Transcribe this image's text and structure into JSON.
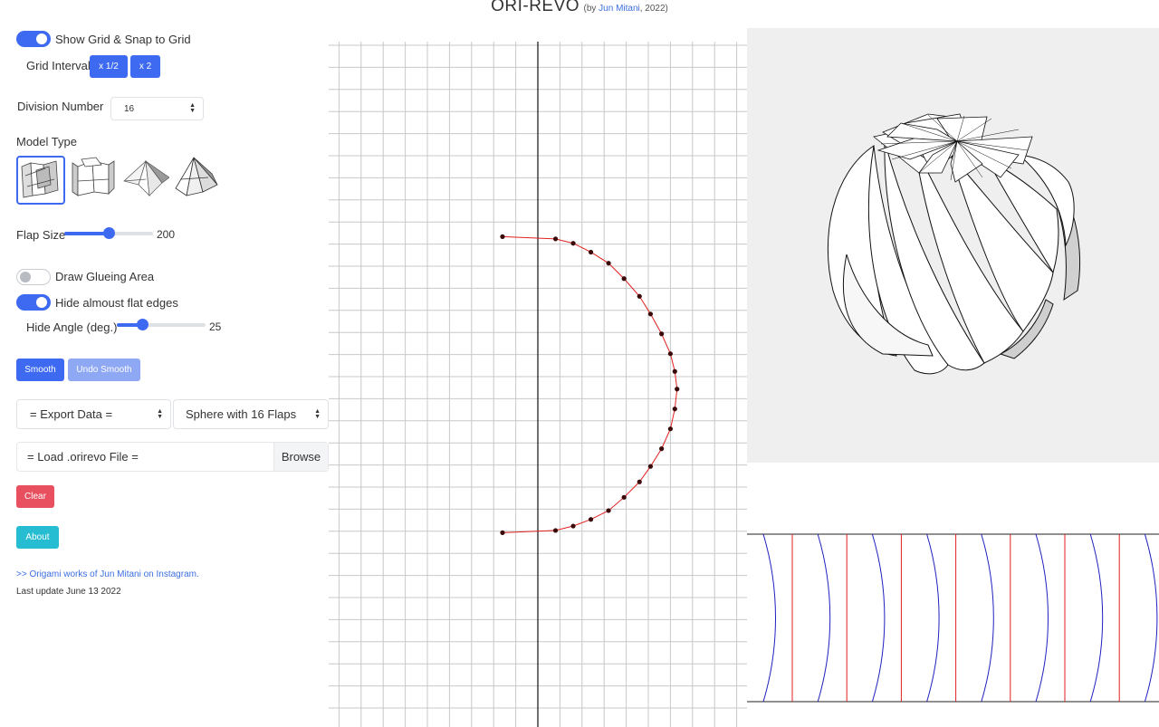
{
  "header": {
    "title": "ORI-REVO",
    "by_prefix": "(by ",
    "author": "Jun Mitani",
    "by_suffix": ", 2022)"
  },
  "controls": {
    "show_grid": {
      "label": "Show Grid & Snap to Grid",
      "checked": true
    },
    "grid_interval": {
      "label": "Grid Interval",
      "half_button": "x 1/2",
      "double_button": "x 2"
    },
    "division_number": {
      "label": "Division Number",
      "value": "16"
    },
    "model_type": {
      "label": "Model Type",
      "selected_index": 0,
      "options": [
        "model-type-1-icon",
        "model-type-2-icon",
        "model-type-3-icon",
        "model-type-4-icon"
      ]
    },
    "flap_size": {
      "label": "Flap Size",
      "value": "200",
      "level": 0.5
    },
    "draw_glueing_area": {
      "label": "Draw Glueing Area",
      "checked": false
    },
    "hide_flat_edges": {
      "label": "Hide almoust flat edges",
      "checked": true
    },
    "hide_angle": {
      "label": "Hide Angle (deg.)",
      "value": "25",
      "level": 0.28
    },
    "smooth_button": "Smooth",
    "undo_smooth_button": "Undo Smooth",
    "export_select": "= Export Data =",
    "preset_select": "Sphere with 16 Flaps",
    "load_file": {
      "placeholder": "= Load .orirevo File =",
      "browse": "Browse"
    },
    "clear_button": "Clear",
    "about_button": "About",
    "instagram_link": ">> Origami works of Jun Mitani on Instagram.",
    "last_update": "Last update June 13 2022"
  },
  "colors": {
    "accent": "#3d6af0",
    "danger": "#e9505f",
    "info": "#26bcd1",
    "curve": "#e02020",
    "mountain_fold": "#e02020",
    "valley_fold": "#2020c0"
  },
  "profile_curve": {
    "points": [
      [
        -1.6,
        6.5
      ],
      [
        0.8,
        6.4
      ],
      [
        1.6,
        6.2
      ],
      [
        2.4,
        5.8
      ],
      [
        3.2,
        5.3
      ],
      [
        3.9,
        4.6
      ],
      [
        4.6,
        3.8
      ],
      [
        5.1,
        3.0
      ],
      [
        5.6,
        2.1
      ],
      [
        6.0,
        1.2
      ],
      [
        6.2,
        0.4
      ],
      [
        6.3,
        -0.4
      ],
      [
        6.2,
        -1.3
      ],
      [
        6.0,
        -2.2
      ],
      [
        5.6,
        -3.1
      ],
      [
        5.1,
        -3.9
      ],
      [
        4.6,
        -4.6
      ],
      [
        3.9,
        -5.3
      ],
      [
        3.2,
        -5.9
      ],
      [
        2.4,
        -6.3
      ],
      [
        1.6,
        -6.6
      ],
      [
        0.8,
        -6.8
      ],
      [
        -1.6,
        -6.9
      ]
    ]
  }
}
